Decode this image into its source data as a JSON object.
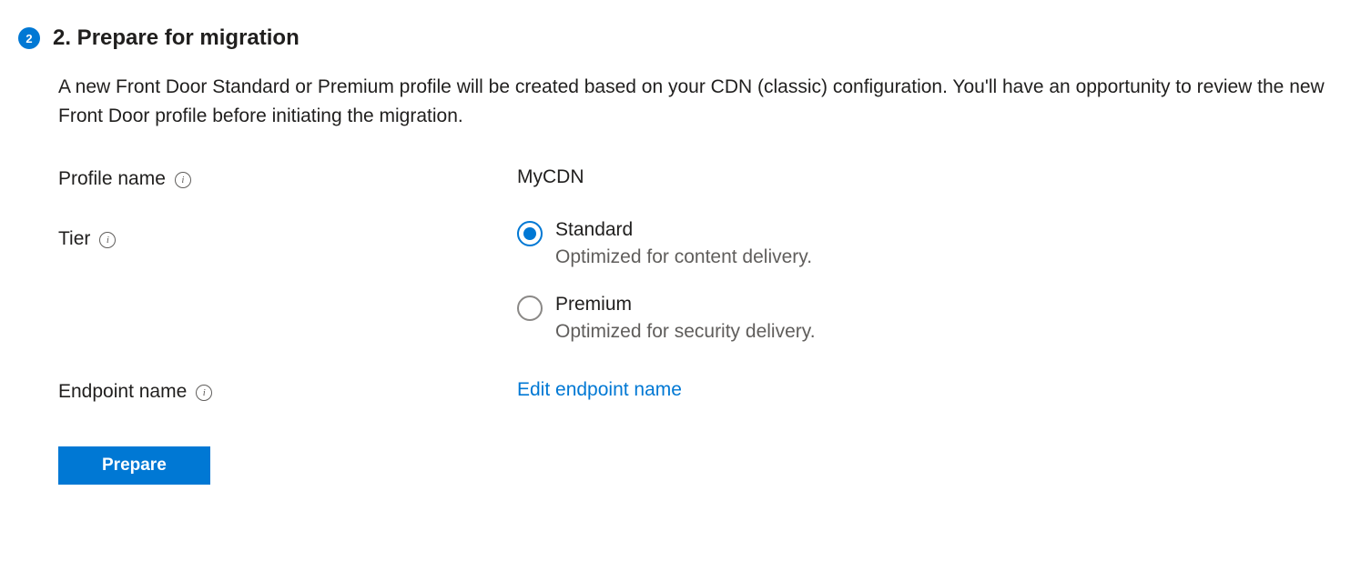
{
  "section": {
    "step_number": "2",
    "title": "2. Prepare for migration",
    "description": "A new Front Door Standard or Premium profile will be created based on your CDN (classic) configuration. You'll have an opportunity to review the new Front Door profile before initiating the migration."
  },
  "form": {
    "profile_name": {
      "label": "Profile name",
      "value": "MyCDN"
    },
    "tier": {
      "label": "Tier",
      "options": [
        {
          "label": "Standard",
          "description": "Optimized for content delivery.",
          "selected": true
        },
        {
          "label": "Premium",
          "description": "Optimized for security delivery.",
          "selected": false
        }
      ]
    },
    "endpoint_name": {
      "label": "Endpoint name",
      "link_text": "Edit endpoint name"
    }
  },
  "actions": {
    "prepare_label": "Prepare"
  }
}
